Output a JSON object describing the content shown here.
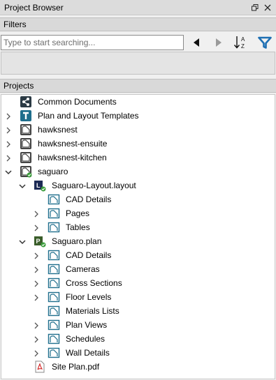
{
  "panel": {
    "title": "Project Browser",
    "filters_header": "Filters",
    "projects_header": "Projects",
    "search_placeholder": "Type to start searching...",
    "search_value": ""
  },
  "tree": [
    {
      "label": "Common Documents",
      "icon": "share-icon",
      "level": 0,
      "chevron": "none"
    },
    {
      "label": "Plan and Layout Templates",
      "icon": "template-icon",
      "level": 0,
      "chevron": "right"
    },
    {
      "label": "hawksnest",
      "icon": "project-icon",
      "level": 0,
      "chevron": "right"
    },
    {
      "label": "hawksnest-ensuite",
      "icon": "project-icon",
      "level": 0,
      "chevron": "right"
    },
    {
      "label": "hawksnest-kitchen",
      "icon": "project-icon",
      "level": 0,
      "chevron": "right"
    },
    {
      "label": "saguaro",
      "icon": "project-open-icon",
      "level": 0,
      "chevron": "down"
    },
    {
      "label": "Saguaro-Layout.layout",
      "icon": "layout-file-icon",
      "level": 1,
      "chevron": "down"
    },
    {
      "label": "CAD Details",
      "icon": "folder-icon",
      "level": 2,
      "chevron": "none"
    },
    {
      "label": "Pages",
      "icon": "folder-icon",
      "level": 2,
      "chevron": "right"
    },
    {
      "label": "Tables",
      "icon": "folder-icon",
      "level": 2,
      "chevron": "right"
    },
    {
      "label": "Saguaro.plan",
      "icon": "plan-file-icon",
      "level": 1,
      "chevron": "down"
    },
    {
      "label": "CAD Details",
      "icon": "folder-icon",
      "level": 2,
      "chevron": "right"
    },
    {
      "label": "Cameras",
      "icon": "folder-icon",
      "level": 2,
      "chevron": "right"
    },
    {
      "label": "Cross Sections",
      "icon": "folder-icon",
      "level": 2,
      "chevron": "right"
    },
    {
      "label": "Floor Levels",
      "icon": "folder-icon",
      "level": 2,
      "chevron": "right"
    },
    {
      "label": "Materials Lists",
      "icon": "folder-icon",
      "level": 2,
      "chevron": "none"
    },
    {
      "label": "Plan Views",
      "icon": "folder-icon",
      "level": 2,
      "chevron": "right"
    },
    {
      "label": "Schedules",
      "icon": "folder-icon",
      "level": 2,
      "chevron": "right"
    },
    {
      "label": "Wall Details",
      "icon": "folder-icon",
      "level": 2,
      "chevron": "right"
    },
    {
      "label": "Site Plan.pdf",
      "icon": "pdf-icon",
      "level": 1,
      "chevron": "none"
    }
  ],
  "colors": {
    "filter_accent": "#1e6fb3",
    "folder_teal": "#1e6e8c",
    "dark_icon": "#2b3a44",
    "status_green": "#3a9d3a"
  }
}
